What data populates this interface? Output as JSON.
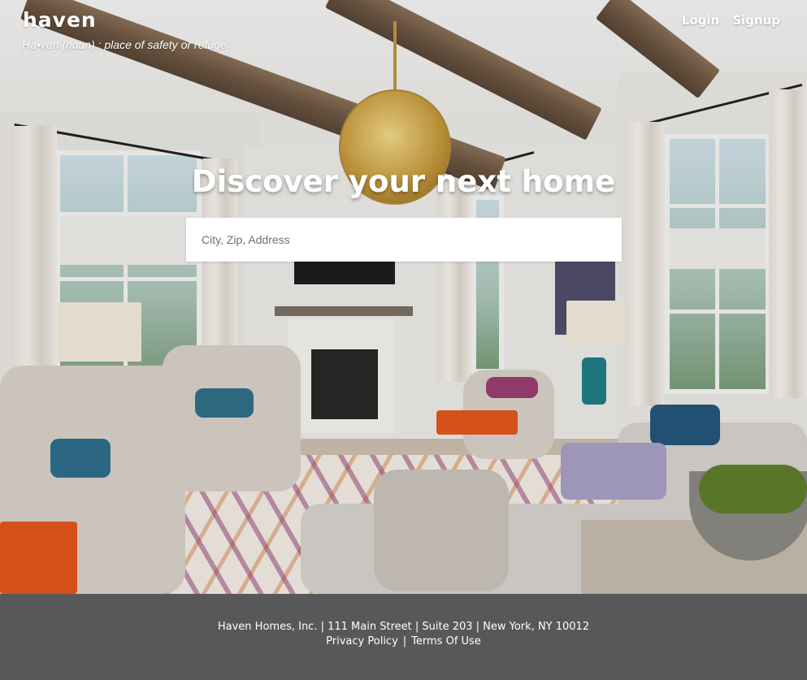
{
  "brand": {
    "logo": "haven",
    "tagline": "Ha•ven (noun) : place of safety or refuge."
  },
  "nav": {
    "login": "Login",
    "signup": "Signup"
  },
  "hero": {
    "headline": "Discover your next home",
    "image": "living-room-photo",
    "search": {
      "placeholder": "City, Zip, Address",
      "value": ""
    }
  },
  "footer": {
    "address": "Haven Homes, Inc. | 111 Main Street | Suite 203 | New York, NY 10012",
    "privacy": "Privacy Policy",
    "separator": "|",
    "terms": "Terms Of Use",
    "background": "#585858"
  }
}
